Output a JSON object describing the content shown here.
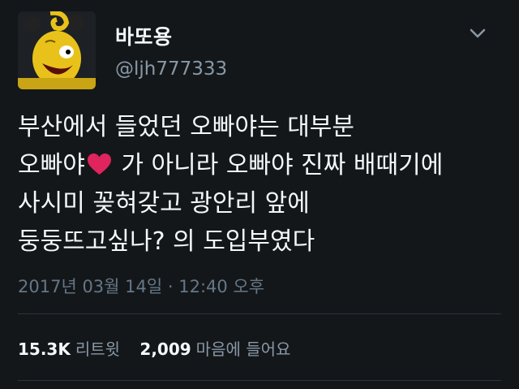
{
  "profile": {
    "display_name": "바또용",
    "handle": "@ljh777333",
    "avatar_icon": "yellow-cartoon-character-avatar"
  },
  "tweet": {
    "lines": [
      "부산에서 들었던 오빠야는 대부분",
      "오빠야",
      "가 아니라 오빠야 진짜 배때기에",
      "사시미 꽂혀갖고 광안리 앞에",
      "둥둥뜨고싶나? 의 도입부였다"
    ],
    "emoji": "heart-emoji"
  },
  "meta": {
    "timestamp": "2017년 03월 14일 · 12:40 오후"
  },
  "stats": {
    "retweets_count": "15.3K",
    "retweets_label": "리트윗",
    "likes_count": "2,009",
    "likes_label": "마음에 들어요"
  },
  "colors": {
    "background": "#14171a",
    "primary_text": "#f5f8fa",
    "secondary_text": "#8899a6",
    "heart": "#e0245e"
  }
}
